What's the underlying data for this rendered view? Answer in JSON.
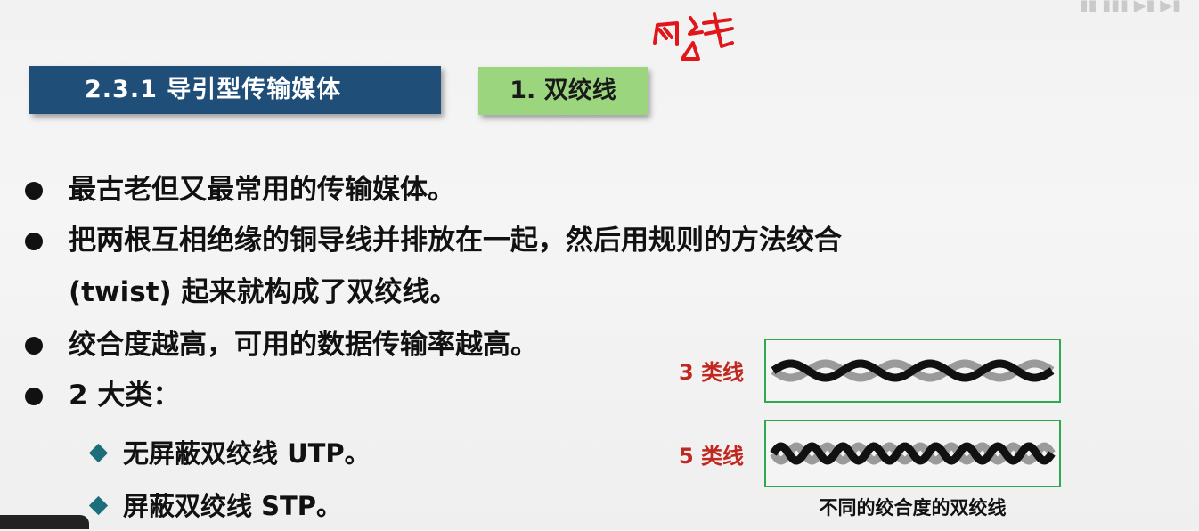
{
  "header": {
    "section_label": "2.3.1  导引型传输媒体",
    "topic_label": "1. 双绞线"
  },
  "annotation": {
    "handwritten_note": "网线"
  },
  "bullets": [
    {
      "text": "最古老但又最常用的传输媒体。"
    },
    {
      "text_line1": "把两根互相绝缘的铜导线并排放在一起，然后用规则的方法绞合",
      "text_line2": "(twist) 起来就构成了双绞线。"
    },
    {
      "text": "绞合度越高，可用的数据传输率越高。"
    },
    {
      "text": "2 大类："
    }
  ],
  "subitems": [
    {
      "text": "无屏蔽双绞线 UTP。"
    },
    {
      "text": "屏蔽双绞线 STP。"
    }
  ],
  "figure": {
    "cat3_label": "3 类线",
    "cat5_label": "5 类线",
    "caption": "不同的绞合度的双绞线",
    "cat3_twists": 4,
    "cat5_twists": 9
  },
  "colors": {
    "section_bg": "#1f4e79",
    "topic_bg": "#9bd67f",
    "label_red": "#c0271f",
    "panel_border": "#2fa84f",
    "diamond": "#1c6f7a",
    "handwriting": "#e0161b"
  }
}
